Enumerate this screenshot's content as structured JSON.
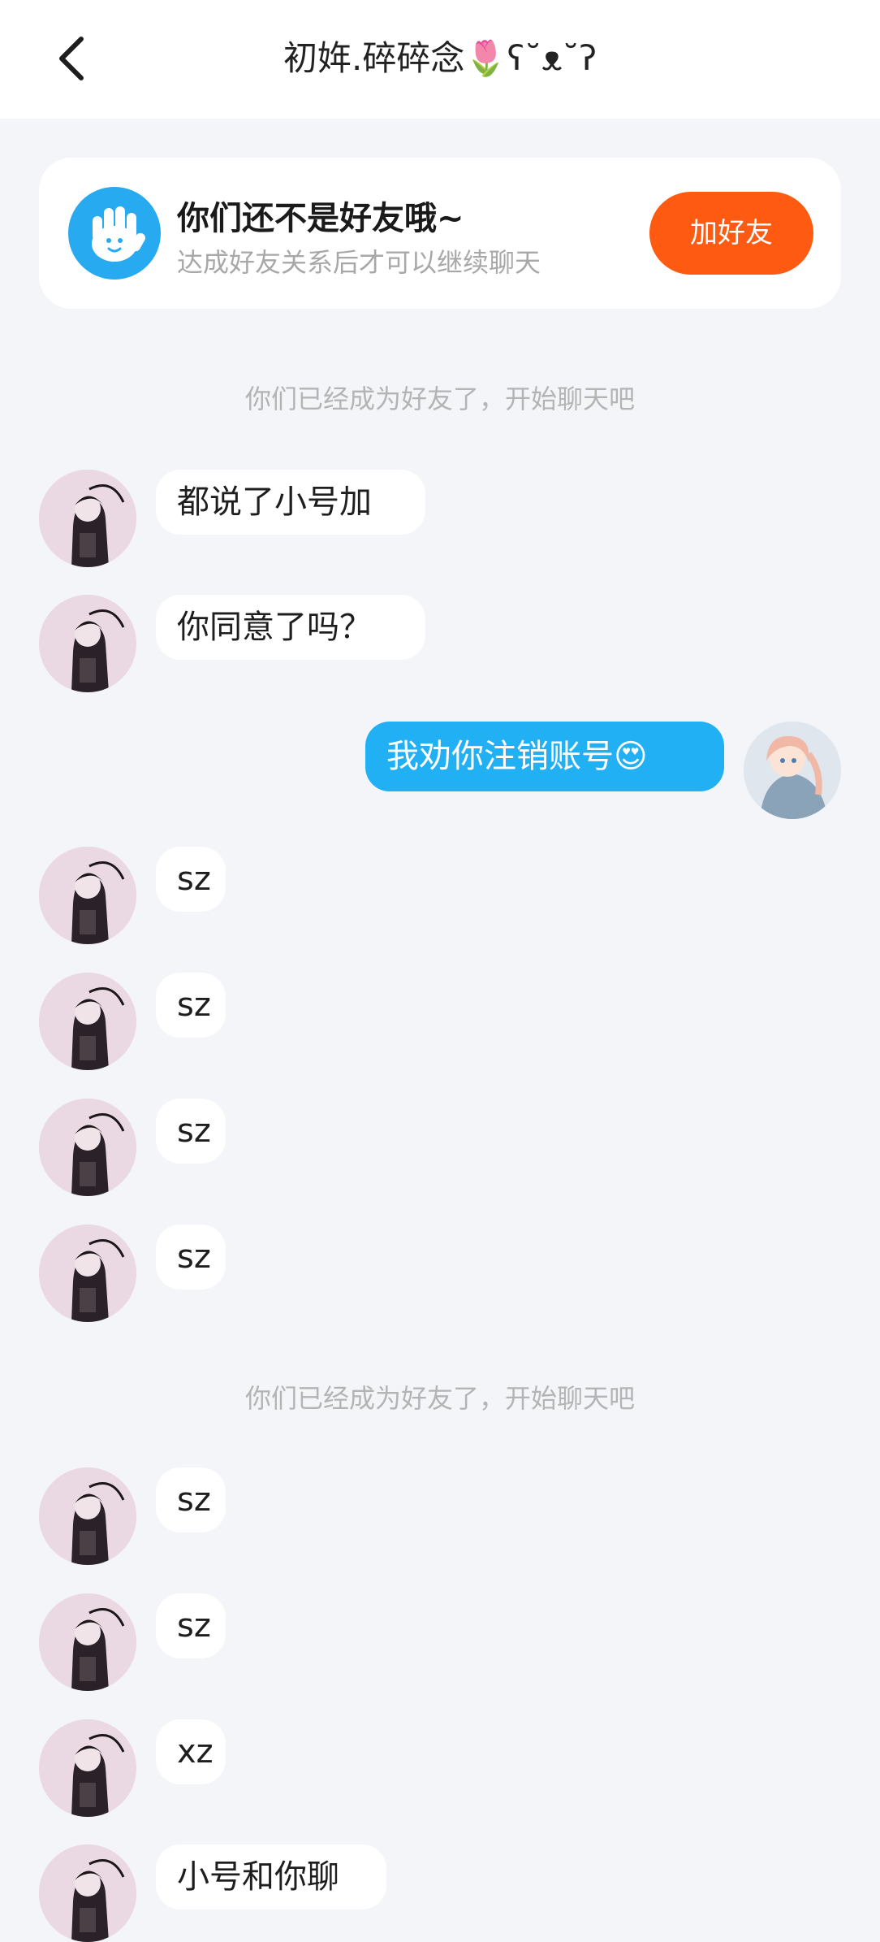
{
  "header": {
    "title": "初姩.碎碎念🌷ʕ˘ᴥ˘ʔ"
  },
  "friend_card": {
    "title": "你们还不是好友哦~",
    "subtitle": "达成好友关系后才可以继续聊天",
    "button_label": "加好友"
  },
  "system_messages": [
    "你们已经成为好友了，开始聊天吧",
    "你们已经成为好友了，开始聊天吧"
  ],
  "messages": [
    {
      "side": "left",
      "text": "都说了小号加"
    },
    {
      "side": "left",
      "text": "你同意了吗？"
    },
    {
      "side": "right",
      "text": "我劝你注销账号😍"
    },
    {
      "side": "left",
      "text": "sz"
    },
    {
      "side": "left",
      "text": "sz"
    },
    {
      "side": "left",
      "text": "sz"
    },
    {
      "side": "left",
      "text": "sz"
    },
    {
      "side": "left",
      "text": "sz"
    },
    {
      "side": "left",
      "text": "sz"
    },
    {
      "side": "left",
      "text": "xz"
    },
    {
      "side": "left",
      "text": "小号和你聊"
    }
  ],
  "colors": {
    "background": "#f3f5f9",
    "outgoing_bubble": "#22b0f4",
    "add_button": "#fe5a12",
    "card_icon": "#27aaf0"
  }
}
